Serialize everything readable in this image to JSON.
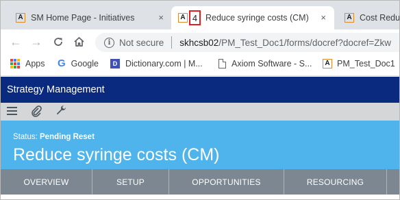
{
  "browser": {
    "tabs": [
      {
        "favicon": "A",
        "title": "SM Home Page - Initiatives",
        "close": "×"
      },
      {
        "favicon": "A",
        "badge": "4",
        "title": "Reduce syringe costs (CM)",
        "close": "×"
      },
      {
        "favicon": "A",
        "title": "Cost Redu"
      }
    ],
    "address": {
      "security": "Not secure",
      "host": "skhcsb02",
      "path": "/PM_Test_Doc1/forms/docref?docref=Zkw"
    },
    "bookmarks": [
      {
        "icon": "apps-grid-icon",
        "label": "Apps"
      },
      {
        "icon": "google-g-icon",
        "label": "Google"
      },
      {
        "icon": "dictionary-icon",
        "label": "Dictionary.com | M..."
      },
      {
        "icon": "document-icon",
        "label": "Axiom Software - S..."
      },
      {
        "icon": "axiom-a-icon",
        "label": "PM_Test_Doc1"
      }
    ]
  },
  "app": {
    "title": "Strategy Management",
    "toolbar": {
      "menu_icon": "hamburger-menu-icon",
      "attach_icon": "paperclip-icon",
      "settings_icon": "wrench-icon"
    },
    "status_label": "Status:",
    "status_value": "Pending Reset",
    "heading": "Reduce syringe costs (CM)",
    "tabs": [
      "OVERVIEW",
      "SETUP",
      "OPPORTUNITIES",
      "RESOURCING"
    ]
  },
  "colors": {
    "header": "#0a2a80",
    "banner": "#4fb4ec",
    "tabs": "#7d8791",
    "toolbar": "#d4d6d8",
    "highlight": "#e02020"
  }
}
